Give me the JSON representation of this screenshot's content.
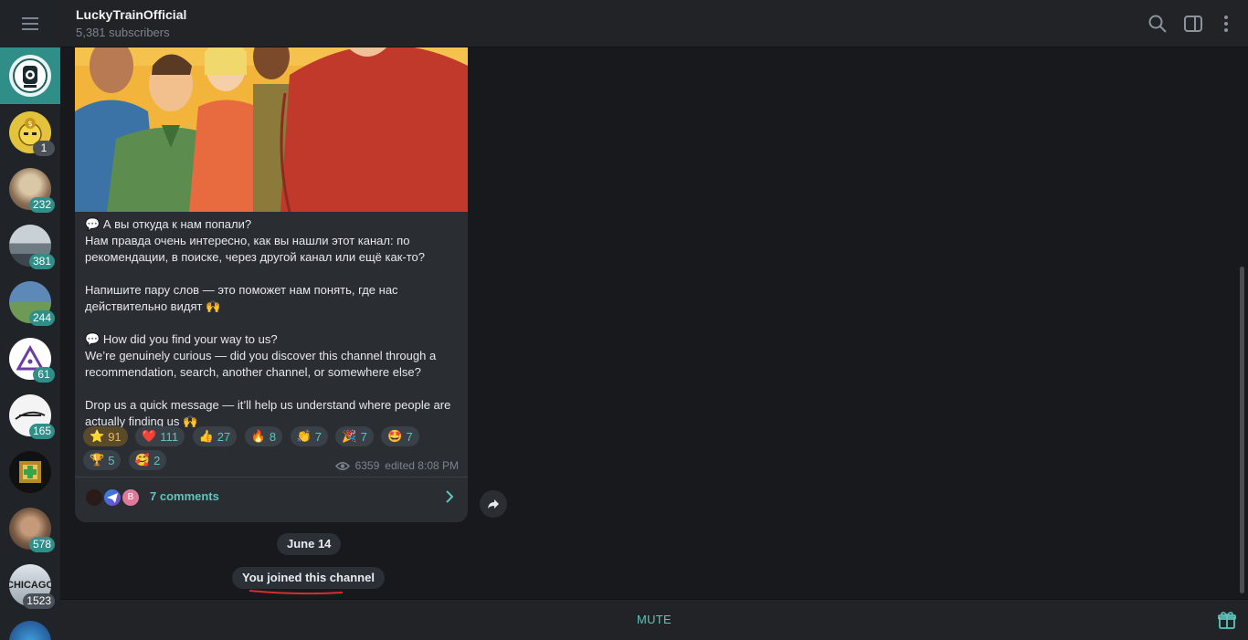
{
  "header": {
    "channel_name": "LuckyTrainOfficial",
    "subscribers": "5,381 subscribers",
    "icons": [
      "search-icon",
      "sidebar-toggle-icon",
      "more-vert-icon"
    ]
  },
  "sidebar": {
    "menu_icon": "hamburger-icon",
    "chats": [
      {
        "name": "luckytrain",
        "badge": "",
        "color": "#1e6f6a"
      },
      {
        "name": "coin-cat",
        "badge": "1",
        "muted": true,
        "color": "#e4c33c"
      },
      {
        "name": "channel-3",
        "badge": "232",
        "color": "#8a6e55"
      },
      {
        "name": "channel-4",
        "badge": "381",
        "color": "#8d9aa3"
      },
      {
        "name": "channel-5",
        "badge": "244",
        "color": "#5d89b8"
      },
      {
        "name": "channel-6",
        "badge": "61",
        "color": "#ffffff"
      },
      {
        "name": "channel-7",
        "badge": "165",
        "color": "#f4f4f4"
      },
      {
        "name": "channel-8",
        "badge": "",
        "color": "#b28a2a"
      },
      {
        "name": "channel-9",
        "badge": "578",
        "color": "#7a5b45"
      },
      {
        "name": "channel-10",
        "badge": "1523",
        "muted": true,
        "color": "#cfd6dd",
        "label": "CHICAGO"
      },
      {
        "name": "channel-11",
        "badge": "",
        "color": "#2f5fa0"
      }
    ]
  },
  "message": {
    "ru_heading": "А вы откуда к нам попали?",
    "ru_p1": "Нам правда очень интересно, как вы нашли этот канал: по рекомендации, в поиске, через другой канал или ещё как-то?",
    "ru_p2": "Напишите пару слов — это поможет нам понять, где нас действительно видят 🙌",
    "en_heading": "How did you find your way to us?",
    "en_p1": "We’re genuinely curious — did you discover this channel through a recommendation, search, another channel, or somewhere else?",
    "en_p2": "Drop us a quick message — it’ll help us understand where people are actually finding us 🙌",
    "speech_icon": "💬",
    "reactions": [
      {
        "emoji": "⭐",
        "count": "91",
        "mine": true
      },
      {
        "emoji": "❤️",
        "count": "111"
      },
      {
        "emoji": "👍",
        "count": "27"
      },
      {
        "emoji": "🔥",
        "count": "8"
      },
      {
        "emoji": "👏",
        "count": "7"
      },
      {
        "emoji": "🎉",
        "count": "7"
      },
      {
        "emoji": "🤩",
        "count": "7"
      },
      {
        "emoji": "🏆",
        "count": "5"
      },
      {
        "emoji": "🥰",
        "count": "2"
      }
    ],
    "views": "6359",
    "edited": "edited 8:08 PM",
    "comments_label": "7 comments",
    "commenter_initial": "B"
  },
  "service": {
    "date": "June 14",
    "joined": "You joined this channel"
  },
  "footer": {
    "mute_label": "MUTE",
    "gift_icon": "gift-icon"
  },
  "colors": {
    "accent": "#5fc4bc",
    "active": "#2f8e87",
    "bubble": "#2a2e33",
    "background": "#17191c",
    "underline": "#d32f2f"
  }
}
